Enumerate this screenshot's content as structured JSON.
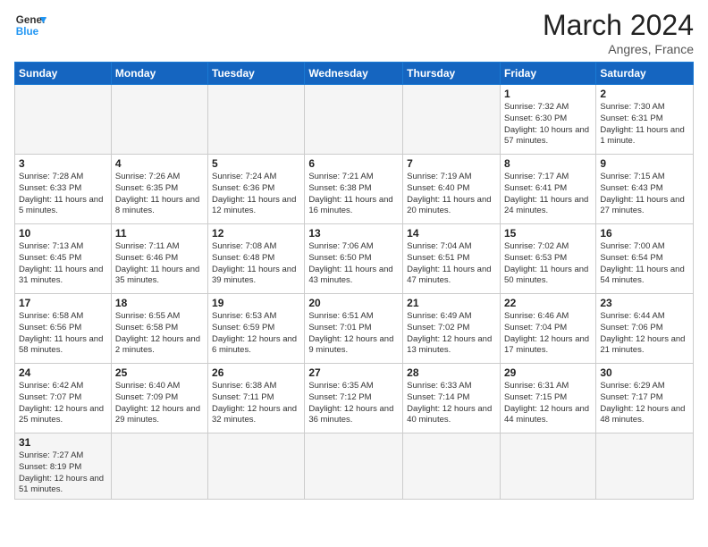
{
  "header": {
    "logo_general": "General",
    "logo_blue": "Blue",
    "month_title": "March 2024",
    "location": "Angres, France"
  },
  "weekdays": [
    "Sunday",
    "Monday",
    "Tuesday",
    "Wednesday",
    "Thursday",
    "Friday",
    "Saturday"
  ],
  "weeks": [
    [
      {
        "day": "",
        "info": "",
        "empty": true
      },
      {
        "day": "",
        "info": "",
        "empty": true
      },
      {
        "day": "",
        "info": "",
        "empty": true
      },
      {
        "day": "",
        "info": "",
        "empty": true
      },
      {
        "day": "",
        "info": "",
        "empty": true
      },
      {
        "day": "1",
        "info": "Sunrise: 7:32 AM\nSunset: 6:30 PM\nDaylight: 10 hours\nand 57 minutes."
      },
      {
        "day": "2",
        "info": "Sunrise: 7:30 AM\nSunset: 6:31 PM\nDaylight: 11 hours\nand 1 minute."
      }
    ],
    [
      {
        "day": "3",
        "info": "Sunrise: 7:28 AM\nSunset: 6:33 PM\nDaylight: 11 hours\nand 5 minutes."
      },
      {
        "day": "4",
        "info": "Sunrise: 7:26 AM\nSunset: 6:35 PM\nDaylight: 11 hours\nand 8 minutes."
      },
      {
        "day": "5",
        "info": "Sunrise: 7:24 AM\nSunset: 6:36 PM\nDaylight: 11 hours\nand 12 minutes."
      },
      {
        "day": "6",
        "info": "Sunrise: 7:21 AM\nSunset: 6:38 PM\nDaylight: 11 hours\nand 16 minutes."
      },
      {
        "day": "7",
        "info": "Sunrise: 7:19 AM\nSunset: 6:40 PM\nDaylight: 11 hours\nand 20 minutes."
      },
      {
        "day": "8",
        "info": "Sunrise: 7:17 AM\nSunset: 6:41 PM\nDaylight: 11 hours\nand 24 minutes."
      },
      {
        "day": "9",
        "info": "Sunrise: 7:15 AM\nSunset: 6:43 PM\nDaylight: 11 hours\nand 27 minutes."
      }
    ],
    [
      {
        "day": "10",
        "info": "Sunrise: 7:13 AM\nSunset: 6:45 PM\nDaylight: 11 hours\nand 31 minutes."
      },
      {
        "day": "11",
        "info": "Sunrise: 7:11 AM\nSunset: 6:46 PM\nDaylight: 11 hours\nand 35 minutes."
      },
      {
        "day": "12",
        "info": "Sunrise: 7:08 AM\nSunset: 6:48 PM\nDaylight: 11 hours\nand 39 minutes."
      },
      {
        "day": "13",
        "info": "Sunrise: 7:06 AM\nSunset: 6:50 PM\nDaylight: 11 hours\nand 43 minutes."
      },
      {
        "day": "14",
        "info": "Sunrise: 7:04 AM\nSunset: 6:51 PM\nDaylight: 11 hours\nand 47 minutes."
      },
      {
        "day": "15",
        "info": "Sunrise: 7:02 AM\nSunset: 6:53 PM\nDaylight: 11 hours\nand 50 minutes."
      },
      {
        "day": "16",
        "info": "Sunrise: 7:00 AM\nSunset: 6:54 PM\nDaylight: 11 hours\nand 54 minutes."
      }
    ],
    [
      {
        "day": "17",
        "info": "Sunrise: 6:58 AM\nSunset: 6:56 PM\nDaylight: 11 hours\nand 58 minutes."
      },
      {
        "day": "18",
        "info": "Sunrise: 6:55 AM\nSunset: 6:58 PM\nDaylight: 12 hours\nand 2 minutes."
      },
      {
        "day": "19",
        "info": "Sunrise: 6:53 AM\nSunset: 6:59 PM\nDaylight: 12 hours\nand 6 minutes."
      },
      {
        "day": "20",
        "info": "Sunrise: 6:51 AM\nSunset: 7:01 PM\nDaylight: 12 hours\nand 9 minutes."
      },
      {
        "day": "21",
        "info": "Sunrise: 6:49 AM\nSunset: 7:02 PM\nDaylight: 12 hours\nand 13 minutes."
      },
      {
        "day": "22",
        "info": "Sunrise: 6:46 AM\nSunset: 7:04 PM\nDaylight: 12 hours\nand 17 minutes."
      },
      {
        "day": "23",
        "info": "Sunrise: 6:44 AM\nSunset: 7:06 PM\nDaylight: 12 hours\nand 21 minutes."
      }
    ],
    [
      {
        "day": "24",
        "info": "Sunrise: 6:42 AM\nSunset: 7:07 PM\nDaylight: 12 hours\nand 25 minutes."
      },
      {
        "day": "25",
        "info": "Sunrise: 6:40 AM\nSunset: 7:09 PM\nDaylight: 12 hours\nand 29 minutes."
      },
      {
        "day": "26",
        "info": "Sunrise: 6:38 AM\nSunset: 7:11 PM\nDaylight: 12 hours\nand 32 minutes."
      },
      {
        "day": "27",
        "info": "Sunrise: 6:35 AM\nSunset: 7:12 PM\nDaylight: 12 hours\nand 36 minutes."
      },
      {
        "day": "28",
        "info": "Sunrise: 6:33 AM\nSunset: 7:14 PM\nDaylight: 12 hours\nand 40 minutes."
      },
      {
        "day": "29",
        "info": "Sunrise: 6:31 AM\nSunset: 7:15 PM\nDaylight: 12 hours\nand 44 minutes."
      },
      {
        "day": "30",
        "info": "Sunrise: 6:29 AM\nSunset: 7:17 PM\nDaylight: 12 hours\nand 48 minutes."
      }
    ],
    [
      {
        "day": "31",
        "info": "Sunrise: 7:27 AM\nSunset: 8:19 PM\nDaylight: 12 hours\nand 51 minutes.",
        "last": true
      },
      {
        "day": "",
        "info": "",
        "empty": true,
        "last": true
      },
      {
        "day": "",
        "info": "",
        "empty": true,
        "last": true
      },
      {
        "day": "",
        "info": "",
        "empty": true,
        "last": true
      },
      {
        "day": "",
        "info": "",
        "empty": true,
        "last": true
      },
      {
        "day": "",
        "info": "",
        "empty": true,
        "last": true
      },
      {
        "day": "",
        "info": "",
        "empty": true,
        "last": true
      }
    ]
  ]
}
